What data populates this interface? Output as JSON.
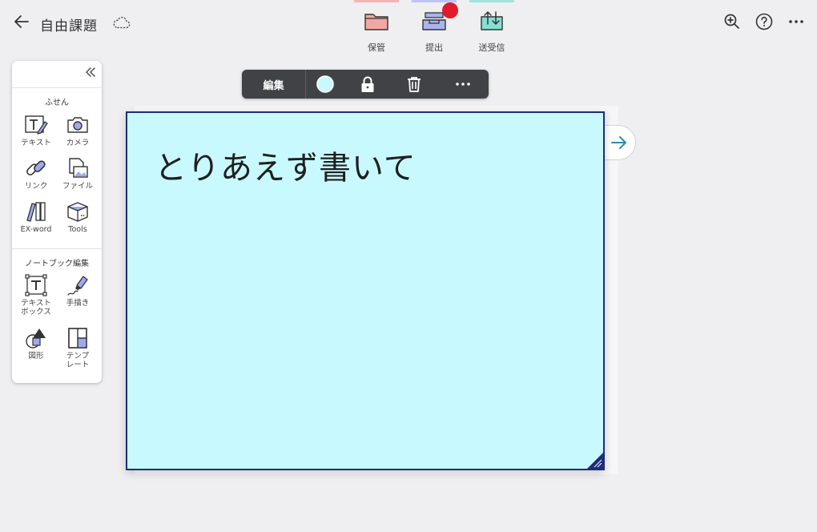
{
  "header": {
    "title": "自由課題",
    "actions": [
      {
        "label": "保管",
        "strip_color": "#f6b3b3"
      },
      {
        "label": "提出",
        "strip_color": "#bcc4f5"
      },
      {
        "label": "送受信",
        "strip_color": "#9ee6dc"
      }
    ]
  },
  "panel": {
    "section1_title": "ふせん",
    "section1_tools": [
      {
        "label": "テキスト",
        "icon": "text-pen-icon"
      },
      {
        "label": "カメラ",
        "icon": "camera-icon"
      },
      {
        "label": "リンク",
        "icon": "link-icon"
      },
      {
        "label": "ファイル",
        "icon": "file-image-icon"
      },
      {
        "label": "EX-word",
        "icon": "books-icon"
      },
      {
        "label": "Tools",
        "icon": "box-icon"
      }
    ],
    "section2_title": "ノートブック編集",
    "section2_tools": [
      {
        "label": "テキスト\nボックス",
        "icon": "textbox-icon"
      },
      {
        "label": "手描き",
        "icon": "marker-icon"
      },
      {
        "label": "図形",
        "icon": "shapes-icon"
      },
      {
        "label": "テンプ\nレート",
        "icon": "template-icon"
      }
    ]
  },
  "toolbar": {
    "edit_label": "編集"
  },
  "note": {
    "text": "とりあえず書いて",
    "color": "#c8f9fe"
  }
}
